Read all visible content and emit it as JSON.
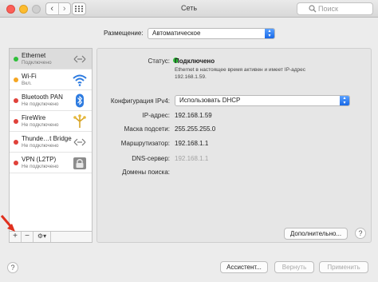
{
  "window": {
    "title": "Сеть",
    "search_placeholder": "Поиск",
    "back_glyph": "‹",
    "forward_glyph": "›"
  },
  "location": {
    "label": "Размещение:",
    "value": "Автоматическое"
  },
  "services": [
    {
      "name": "Ethernet",
      "status": "Подключено",
      "dot_color": "#2fbf3a",
      "icon": "ethernet-icon",
      "selected": true
    },
    {
      "name": "Wi-Fi",
      "status": "Вкл.",
      "dot_color": "#f5a623",
      "icon": "wifi-icon",
      "selected": false
    },
    {
      "name": "Bluetooth PAN",
      "status": "Не подключено",
      "dot_color": "#e0413a",
      "icon": "bluetooth-icon",
      "selected": false
    },
    {
      "name": "FireWire",
      "status": "Не подключено",
      "dot_color": "#e0413a",
      "icon": "firewire-icon",
      "selected": false
    },
    {
      "name": "Thunde…t Bridge",
      "status": "Не подключено",
      "dot_color": "#e0413a",
      "icon": "thunderbolt-bridge-icon",
      "selected": false
    },
    {
      "name": "VPN (L2TP)",
      "status": "Не подключено",
      "dot_color": "#e0413a",
      "icon": "vpn-lock-icon",
      "selected": false
    }
  ],
  "sidebar_tools": {
    "add": "+",
    "remove": "−",
    "action": "⚙▾"
  },
  "detail": {
    "status_label": "Статус:",
    "status_value": "Подключено",
    "status_description_line1": "Ethernet в настоящее время активен и имеет IP-адрес",
    "status_description_line2": "192.168.1.59.",
    "config_label": "Конфигурация IPv4:",
    "config_value": "Использовать DHCP",
    "ip_label": "IP-адрес:",
    "ip_value": "192.168.1.59",
    "mask_label": "Маска подсети:",
    "mask_value": "255.255.255.0",
    "router_label": "Маршрутизатор:",
    "router_value": "192.168.1.1",
    "dns_label": "DNS-сервер:",
    "dns_value": "192.168.1.1",
    "domains_label": "Домены поиска:",
    "advanced_button": "Дополнительно...",
    "help_glyph": "?"
  },
  "footer": {
    "assistant_button": "Ассистент...",
    "revert_button": "Вернуть",
    "apply_button": "Применить",
    "help_glyph": "?"
  },
  "colors": {
    "connected": "#2fbf3a",
    "inactive": "#f5a623",
    "disconnected": "#e0413a",
    "accent": "#1868e6"
  }
}
